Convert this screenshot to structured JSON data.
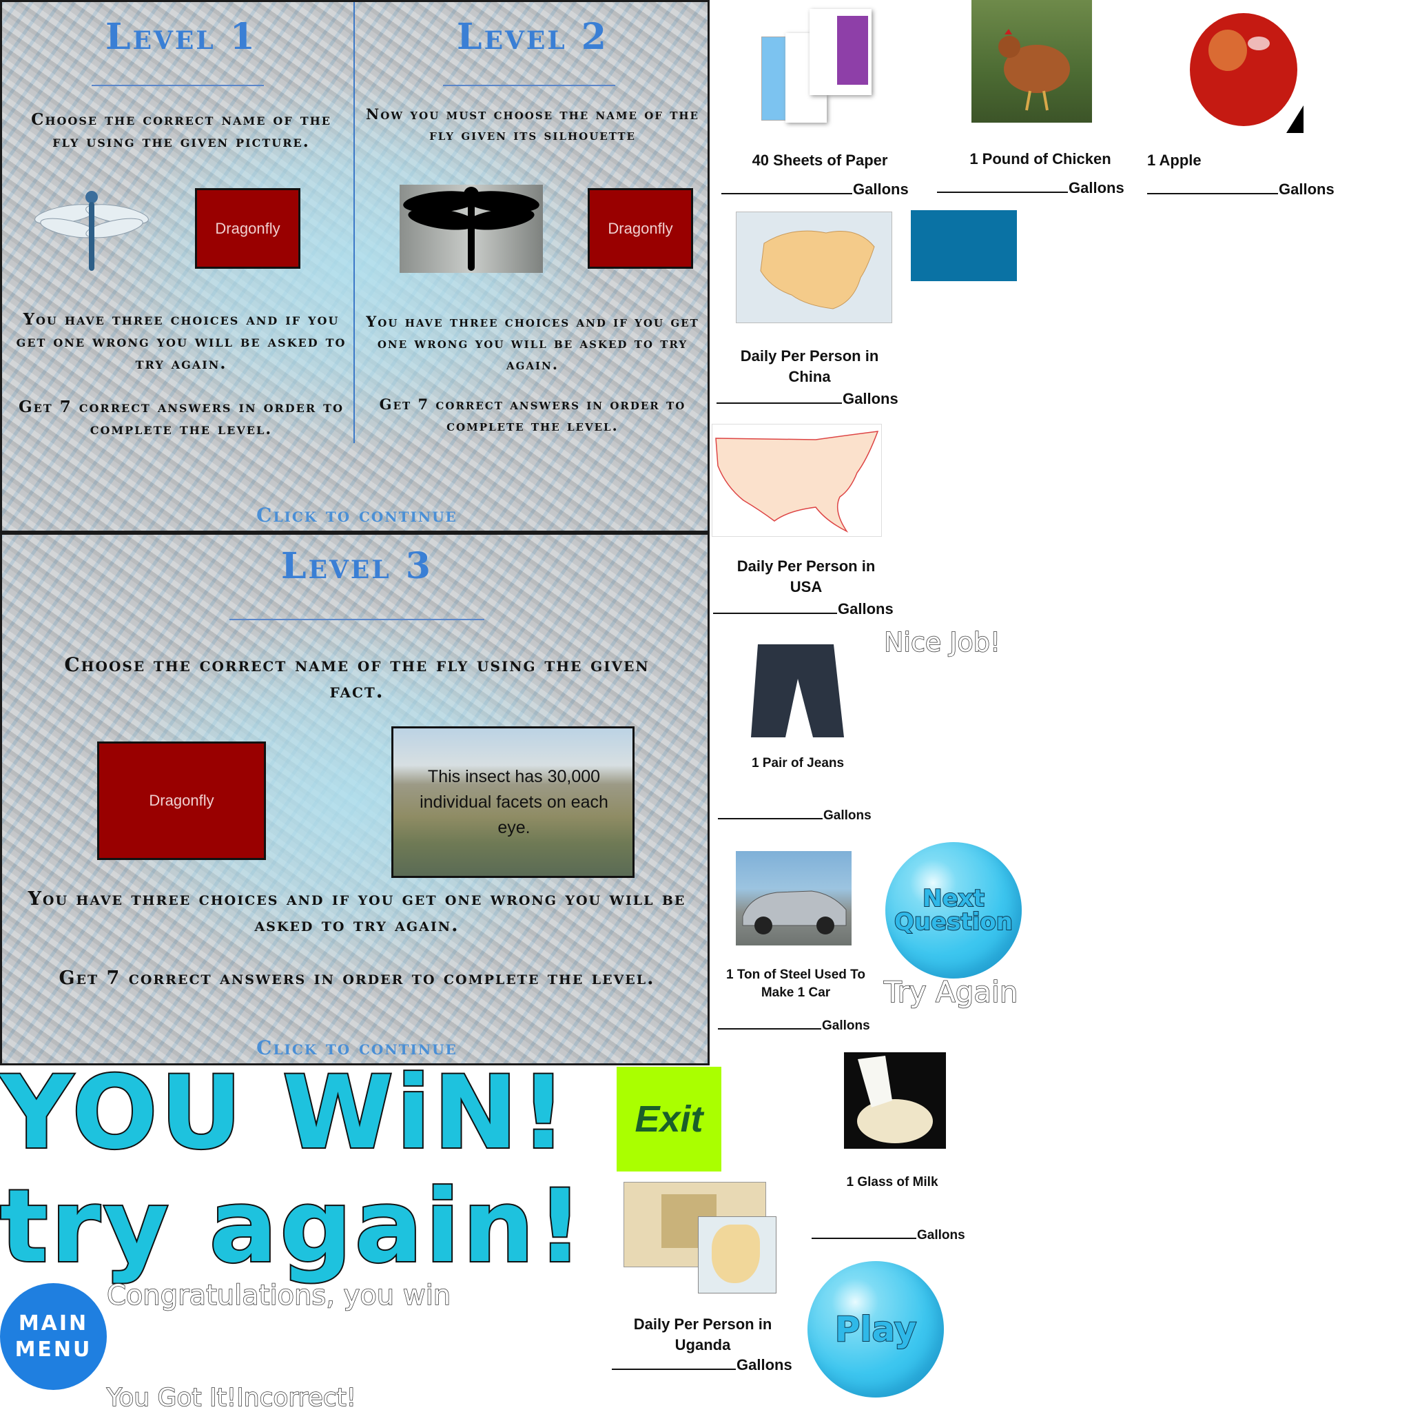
{
  "level1": {
    "title": "Level 1",
    "instruction": "Choose the correct name of the fly using the given picture.",
    "button": "Dragonfly",
    "rules1": "You have three choices and if you get one wrong you will be asked to try again.",
    "rules2": "Get 7 correct answers in order to complete the level."
  },
  "level2": {
    "title": "Level 2",
    "instruction": "Now you must choose the name of the fly given its silhouette",
    "button": "Dragonfly",
    "rules1": "You have three choices and if you get one wrong you will be asked to try again.",
    "rules2": "Get 7 correct answers in order to complete the level."
  },
  "continue_label": "Click to continue",
  "level3": {
    "title": "Level 3",
    "instruction": "Choose the correct name of the fly using the given fact.",
    "button": "Dragonfly",
    "fact": "This insect has 30,000 individual facets on each eye.",
    "rules1": "You have three choices and if you get one wrong you will be asked to try again.",
    "rules2": "Get 7 correct answers in order to complete the level."
  },
  "banners": {
    "win": "YOU WiN!",
    "try_again": "try again!"
  },
  "buttons": {
    "exit": "Exit",
    "main_menu_line1": "MAIN",
    "main_menu_line2": "MENU",
    "next_question_line1": "Next",
    "next_question_line2": "Question",
    "play": "Play"
  },
  "messages": {
    "congrats": "Congratulations, you win",
    "got_it": "You Got It!Incorrect!",
    "nice_job": "Nice Job!",
    "try_again": "Try Again"
  },
  "gallons_word": "Gallons",
  "items": {
    "paper": "40 Sheets of Paper",
    "chicken": "1 Pound of Chicken",
    "apple": "1  Apple",
    "china": "Daily Per Person in China",
    "usa": "Daily Per Person in USA",
    "jeans": "1 Pair of Jeans",
    "steel": "1 Ton of Steel Used To Make 1 Car",
    "milk": "1 Glass of Milk",
    "uganda": "Daily Per Person in Uganda"
  },
  "colors": {
    "title_blue": "#3a7fd5",
    "button_red": "#990000",
    "bubble_cyan": "#1ec2de",
    "exit_green": "#aaff00",
    "square_blue": "#0a72a4"
  }
}
